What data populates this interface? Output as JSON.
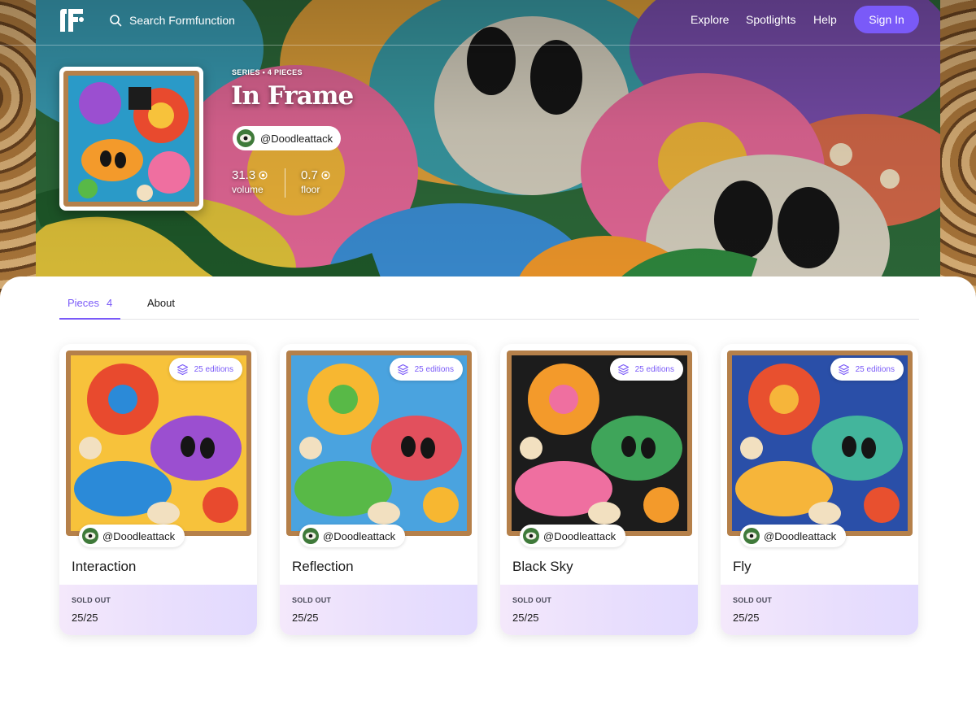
{
  "nav": {
    "search_placeholder": "Search Formfunction",
    "links": [
      "Explore",
      "Spotlights",
      "Help"
    ],
    "signin_label": "Sign In"
  },
  "series": {
    "meta": "SERIES • 4 PIECES",
    "title": "In Frame",
    "creator": "@Doodleattack",
    "volume_value": "31.3",
    "volume_label": "volume",
    "floor_value": "0.7",
    "floor_label": "floor"
  },
  "tabs": {
    "pieces_label": "Pieces",
    "pieces_count": "4",
    "about_label": "About"
  },
  "pieces": [
    {
      "title": "Interaction",
      "creator": "@Doodleattack",
      "editions": "25 editions",
      "status": "SOLD OUT",
      "supply": "25/25",
      "palette": [
        "#e84a2e",
        "#f7c23b",
        "#2b8ad8",
        "#9b4fd0"
      ]
    },
    {
      "title": "Reflection",
      "creator": "@Doodleattack",
      "editions": "25 editions",
      "status": "SOLD OUT",
      "supply": "25/25",
      "palette": [
        "#f7b731",
        "#4aa3df",
        "#58b947",
        "#e2505d"
      ]
    },
    {
      "title": "Black Sky",
      "creator": "@Doodleattack",
      "editions": "25 editions",
      "status": "SOLD OUT",
      "supply": "25/25",
      "palette": [
        "#f39a2b",
        "#1c1c1c",
        "#ef6fa0",
        "#3fa55a"
      ]
    },
    {
      "title": "Fly",
      "creator": "@Doodleattack",
      "editions": "25 editions",
      "status": "SOLD OUT",
      "supply": "25/25",
      "palette": [
        "#e8502f",
        "#2a4fa8",
        "#f6b53a",
        "#43b59c"
      ]
    }
  ],
  "colors": {
    "accent": "#7a5af8",
    "card_footer": "#ebe2fc"
  },
  "icons": {
    "logo": "formfunction-logo",
    "search": "search-icon",
    "currency": "tezos-coin-icon",
    "editions": "layers-icon"
  }
}
